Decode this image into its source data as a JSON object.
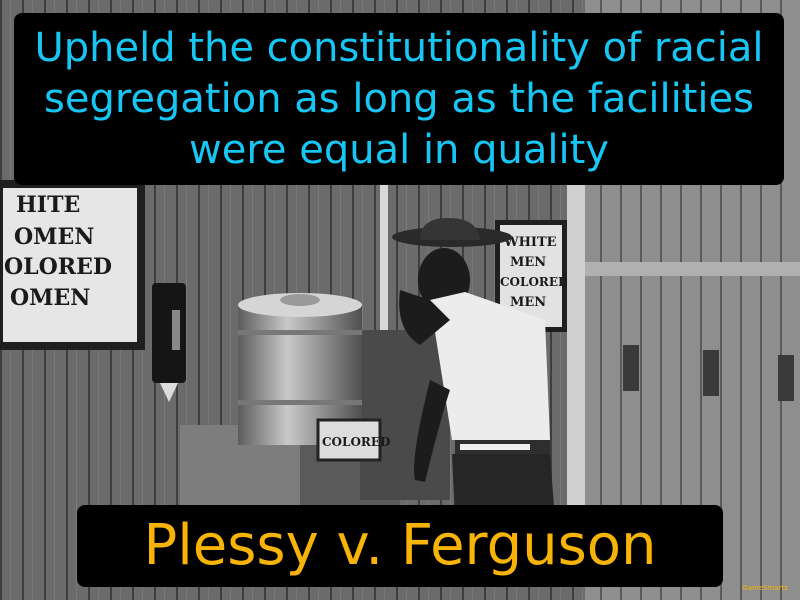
{
  "caption": {
    "text": "Upheld the constitutionality of racial segregation as long as the facilities were equal in quality"
  },
  "term": "Plessy v. Ferguson",
  "brand": "GameSmartz",
  "photo": {
    "left_sign_lines": [
      "HITE",
      "OMEN",
      "OLORED",
      "OMEN"
    ],
    "right_sign_lines": [
      "WHITE",
      "MEN",
      "COLORED",
      "MEN"
    ],
    "fountain_sign": "COLORED"
  },
  "colors": {
    "caption_text": "#18c6f4",
    "term_text": "#f7b306",
    "box_background": "#000000"
  }
}
